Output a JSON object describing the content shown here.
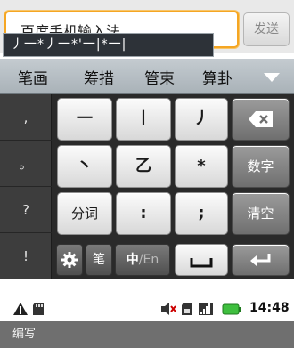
{
  "input": {
    "text": "百度手机输入法",
    "send_label": "发送"
  },
  "composition": {
    "strokes": "丿一*丿一*'一|*一|"
  },
  "candidates": [
    "笔画",
    "筹措",
    "管束",
    "算卦"
  ],
  "left_keys": [
    ",",
    "。",
    "?",
    "!"
  ],
  "keys": {
    "row1": [
      "一",
      "丨",
      "丿"
    ],
    "row2": [
      "丶",
      "乙",
      "*"
    ],
    "row3": [
      "分词",
      ":",
      ";"
    ],
    "numbers_label": "数字",
    "clear_label": "清空"
  },
  "bottom": {
    "stroke_label": "笔",
    "lang_zh": "中",
    "lang_sep": "/",
    "lang_en": "En"
  },
  "status": {
    "time": "14:48"
  },
  "footer": {
    "title": "编写"
  },
  "colors": {
    "field_border": "#f5a623",
    "battery": "#3fbf3f"
  }
}
